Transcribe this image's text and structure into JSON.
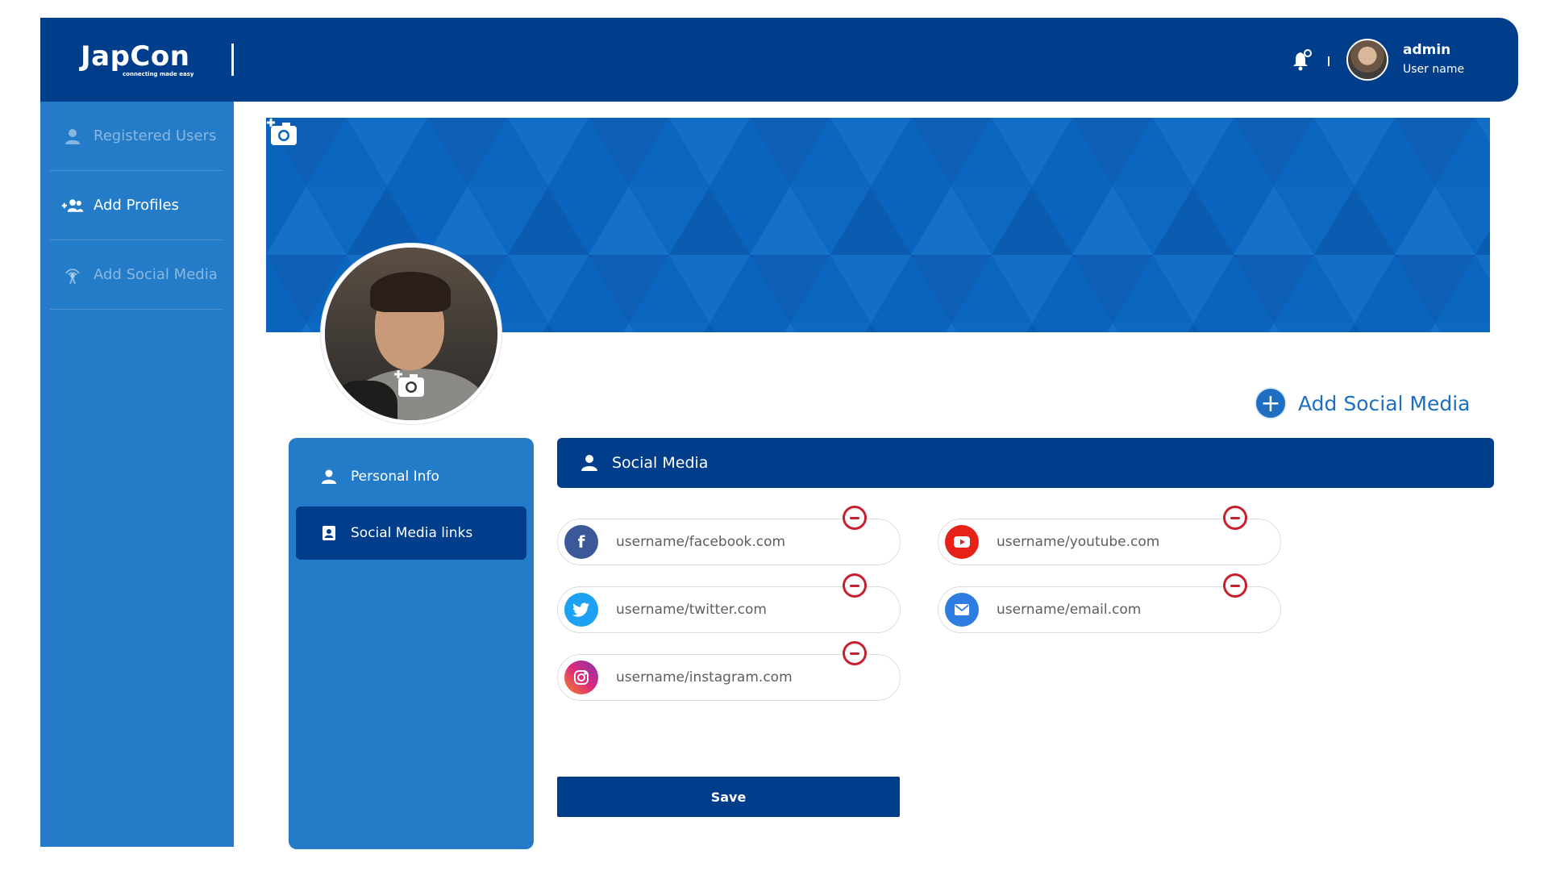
{
  "header": {
    "brand": "JapCon",
    "tagline": "connecting made easy",
    "user_name": "admin",
    "user_role": "User name"
  },
  "sidebar": {
    "items": [
      {
        "label": "Registered Users",
        "icon": "person-icon",
        "state": "dim"
      },
      {
        "label": "Add Profiles",
        "icon": "add-group-icon",
        "state": "active"
      },
      {
        "label": "Add Social Media",
        "icon": "broadcast-icon",
        "state": "dim"
      }
    ]
  },
  "add_social_media": {
    "label": "Add Social Media",
    "icon": "plus-icon"
  },
  "tabs": [
    {
      "label": "Personal Info",
      "icon": "person-icon",
      "active": false
    },
    {
      "label": "Social Media links",
      "icon": "contact-card-icon",
      "active": true
    }
  ],
  "social_media": {
    "title": "Social Media",
    "fields": [
      {
        "network": "facebook",
        "value": "username/facebook.com",
        "color": "#3b5998",
        "glyph": "f"
      },
      {
        "network": "twitter",
        "value": "username/twitter.com",
        "color": "#1da1f2",
        "glyph": "t"
      },
      {
        "network": "instagram",
        "value": "username/instagram.com",
        "color": "#c13584",
        "glyph": "ig"
      },
      {
        "network": "youtube",
        "value": "username/youtube.com",
        "color": "#e62117",
        "glyph": "yt"
      },
      {
        "network": "email",
        "value": "username/email.com",
        "color": "#2f7de1",
        "glyph": "mail"
      }
    ],
    "save_label": "Save"
  },
  "colors": {
    "navy": "#003d8a",
    "blue": "#247cc8",
    "banner": "#0a63bd",
    "remove": "#c8202d"
  }
}
